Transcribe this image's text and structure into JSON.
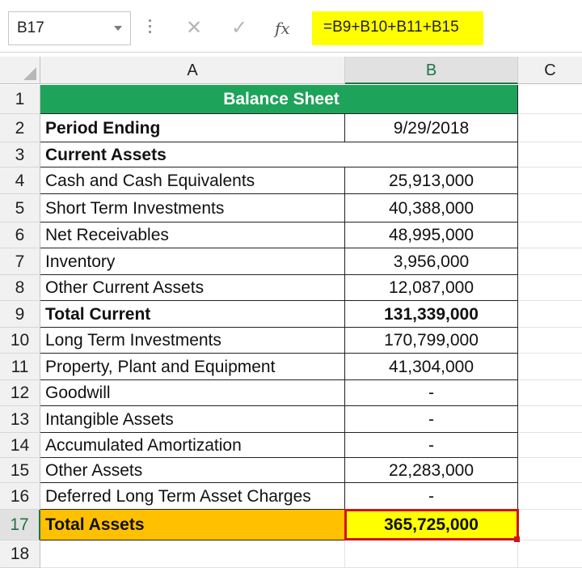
{
  "formula_bar": {
    "name_box": "B17",
    "formula": "=B9+B10+B11+B15",
    "fx_label": "fx"
  },
  "columns": [
    "A",
    "B",
    "C"
  ],
  "rows": [
    {
      "num": "1",
      "a": "Balance Sheet",
      "b": "",
      "style": "title"
    },
    {
      "num": "2",
      "a": "Period Ending",
      "b": "9/29/2018",
      "a_bold": true
    },
    {
      "num": "3",
      "a": "Current Assets",
      "b": "",
      "a_bold": true
    },
    {
      "num": "4",
      "a": "Cash and Cash Equivalents",
      "b": "25,913,000"
    },
    {
      "num": "5",
      "a": "Short Term Investments",
      "b": "40,388,000"
    },
    {
      "num": "6",
      "a": "Net Receivables",
      "b": "48,995,000"
    },
    {
      "num": "7",
      "a": "Inventory",
      "b": "3,956,000"
    },
    {
      "num": "8",
      "a": "Other Current Assets",
      "b": "12,087,000"
    },
    {
      "num": "9",
      "a": "Total Current",
      "b": "131,339,000",
      "a_bold": true,
      "b_bold": true
    },
    {
      "num": "10",
      "a": "Long Term Investments",
      "b": "170,799,000"
    },
    {
      "num": "11",
      "a": "Property, Plant and Equipment",
      "b": "41,304,000"
    },
    {
      "num": "12",
      "a": "Goodwill",
      "b": "-"
    },
    {
      "num": "13",
      "a": "Intangible Assets",
      "b": "-"
    },
    {
      "num": "14",
      "a": "Accumulated Amortization",
      "b": "-"
    },
    {
      "num": "15",
      "a": "Other Assets",
      "b": "22,283,000"
    },
    {
      "num": "16",
      "a": "Deferred Long Term Asset Charges",
      "b": "-"
    },
    {
      "num": "17",
      "a": "Total Assets",
      "b": "365,725,000",
      "style": "total"
    },
    {
      "num": "18",
      "a": "",
      "b": ""
    }
  ],
  "selection": {
    "cell": "B17",
    "color": "#d0121b"
  },
  "colors": {
    "title_bg": "#1ea35a",
    "total_bg": "#ffc000",
    "highlight": "#ffff00",
    "excel_green": "#217346"
  }
}
